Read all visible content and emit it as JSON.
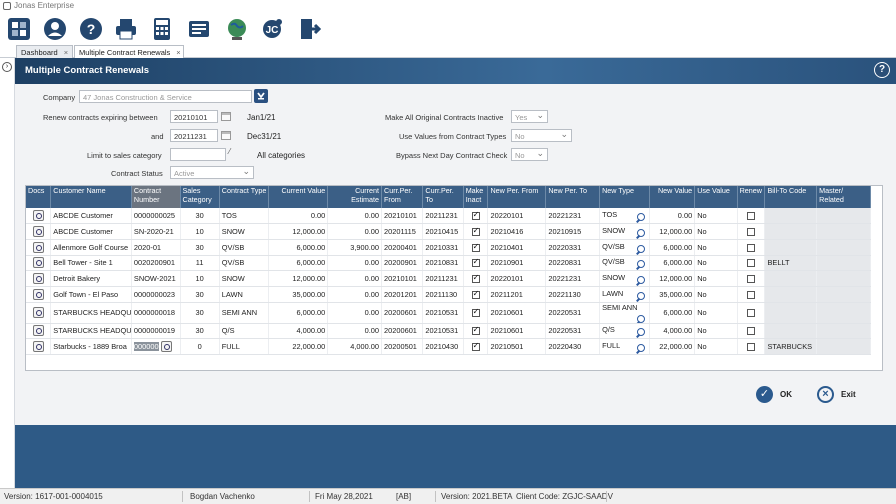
{
  "window": {
    "title": "Jonas Enterprise"
  },
  "toolbar": {
    "icons": [
      "settings-icon",
      "user-icon",
      "help-icon",
      "printer-icon",
      "calculator-icon",
      "contacts-icon",
      "globe-icon",
      "jc-icon",
      "exit-icon"
    ]
  },
  "tabs": [
    {
      "label": "Dashboard"
    },
    {
      "label": "Multiple Contract Renewals"
    }
  ],
  "header": {
    "title": "Multiple Contract Renewals",
    "help": "?"
  },
  "form": {
    "company_label": "Company",
    "company_value": "47 Jonas Construction & Service",
    "renew_label": "Renew contracts expiring between",
    "from_value": "20210101",
    "from_display": "Jan1/21",
    "and_label": "and",
    "to_value": "20211231",
    "to_display": "Dec31/21",
    "sales_label": "Limit to sales category",
    "sales_value": "",
    "sales_display": "All categories",
    "status_label": "Contract Status",
    "status_value": "Active",
    "inactive_label": "Make All Original Contracts Inactive",
    "inactive_value": "Yes",
    "usevalues_label": "Use Values from Contract Types",
    "usevalues_value": "No",
    "bypass_label": "Bypass Next Day Contract Check",
    "bypass_value": "No"
  },
  "grid": {
    "columns": [
      "Docs",
      "Customer Name",
      "Contract Number",
      "Sales Category",
      "Contract Type",
      "Current Value",
      "Current Estimate",
      "Curr.Per. From",
      "Curr.Per. To",
      "Make Inact",
      "New Per. From",
      "New Per. To",
      "New Type",
      "New Value",
      "Use Value",
      "Renew",
      "Bill-To Code",
      "Master/ Related"
    ],
    "rows": [
      {
        "customer": "ABCDE Customer",
        "contract": "0000000025",
        "sales": "30",
        "type": "TOS",
        "cur_value": "0.00",
        "cur_est": "0.00",
        "cur_from": "20210101",
        "cur_to": "20211231",
        "inact": true,
        "new_from": "20220101",
        "new_to": "20221231",
        "new_type": "TOS",
        "new_value": "0.00",
        "use_value": "No",
        "renew": false,
        "billto": "",
        "master": ""
      },
      {
        "customer": "ABCDE Customer",
        "contract": "SN-2020-21",
        "sales": "10",
        "type": "SNOW",
        "cur_value": "12,000.00",
        "cur_est": "0.00",
        "cur_from": "20201115",
        "cur_to": "20210415",
        "inact": true,
        "new_from": "20210416",
        "new_to": "20210915",
        "new_type": "SNOW",
        "new_value": "12,000.00",
        "use_value": "No",
        "renew": false,
        "billto": "",
        "master": ""
      },
      {
        "customer": "Allenmore Golf Course",
        "contract": "2020-01",
        "sales": "30",
        "type": "QV/SB",
        "cur_value": "6,000.00",
        "cur_est": "3,900.00",
        "cur_from": "20200401",
        "cur_to": "20210331",
        "inact": true,
        "new_from": "20210401",
        "new_to": "20220331",
        "new_type": "QV/SB",
        "new_value": "6,000.00",
        "use_value": "No",
        "renew": false,
        "billto": "",
        "master": ""
      },
      {
        "customer": "Bell Tower - Site 1",
        "contract": "0020200901",
        "sales": "11",
        "type": "QV/SB",
        "cur_value": "6,000.00",
        "cur_est": "0.00",
        "cur_from": "20200901",
        "cur_to": "20210831",
        "inact": true,
        "new_from": "20210901",
        "new_to": "20220831",
        "new_type": "QV/SB",
        "new_value": "6,000.00",
        "use_value": "No",
        "renew": false,
        "billto": "BELLT",
        "master": ""
      },
      {
        "customer": "Detroit Bakery",
        "contract": "SNOW-2021",
        "sales": "10",
        "type": "SNOW",
        "cur_value": "12,000.00",
        "cur_est": "0.00",
        "cur_from": "20210101",
        "cur_to": "20211231",
        "inact": true,
        "new_from": "20220101",
        "new_to": "20221231",
        "new_type": "SNOW",
        "new_value": "12,000.00",
        "use_value": "No",
        "renew": false,
        "billto": "",
        "master": ""
      },
      {
        "customer": "Golf Town - El Paso",
        "contract": "0000000023",
        "sales": "30",
        "type": "LAWN",
        "cur_value": "35,000.00",
        "cur_est": "0.00",
        "cur_from": "20201201",
        "cur_to": "20211130",
        "inact": true,
        "new_from": "20211201",
        "new_to": "20221130",
        "new_type": "LAWN",
        "new_value": "35,000.00",
        "use_value": "No",
        "renew": false,
        "billto": "",
        "master": ""
      },
      {
        "customer": "STARBUCKS HEADQUA",
        "contract": "0000000018",
        "sales": "30",
        "type": "SEMI ANN",
        "cur_value": "6,000.00",
        "cur_est": "0.00",
        "cur_from": "20200601",
        "cur_to": "20210531",
        "inact": true,
        "new_from": "20210601",
        "new_to": "20220531",
        "new_type": "SEMI ANN",
        "new_value": "6,000.00",
        "use_value": "No",
        "renew": false,
        "billto": "",
        "master": ""
      },
      {
        "customer": "STARBUCKS HEADQUA",
        "contract": "0000000019",
        "sales": "30",
        "type": "Q/S",
        "cur_value": "4,000.00",
        "cur_est": "0.00",
        "cur_from": "20200601",
        "cur_to": "20210531",
        "inact": true,
        "new_from": "20210601",
        "new_to": "20220531",
        "new_type": "Q/S",
        "new_value": "4,000.00",
        "use_value": "No",
        "renew": false,
        "billto": "",
        "master": ""
      },
      {
        "customer": "Starbucks - 1889 Broa",
        "contract": "000000",
        "sales": "0",
        "type": "FULL",
        "cur_value": "22,000.00",
        "cur_est": "4,000.00",
        "cur_from": "20200501",
        "cur_to": "20210430",
        "inact": true,
        "new_from": "20210501",
        "new_to": "20220430",
        "new_type": "FULL",
        "new_value": "22,000.00",
        "use_value": "No",
        "renew": false,
        "billto": "STARBUCKS",
        "master": ""
      }
    ]
  },
  "buttons": {
    "ok": "OK",
    "exit": "Exit"
  },
  "status": {
    "version_left": "Version: 1617-001-0004015",
    "user": "Bogdan Vachenko",
    "date": "Fri May 28,2021",
    "code": "[AB]",
    "version": "Version: 2021.BETA",
    "client": "Client Code: ZGJC-SAADV"
  }
}
